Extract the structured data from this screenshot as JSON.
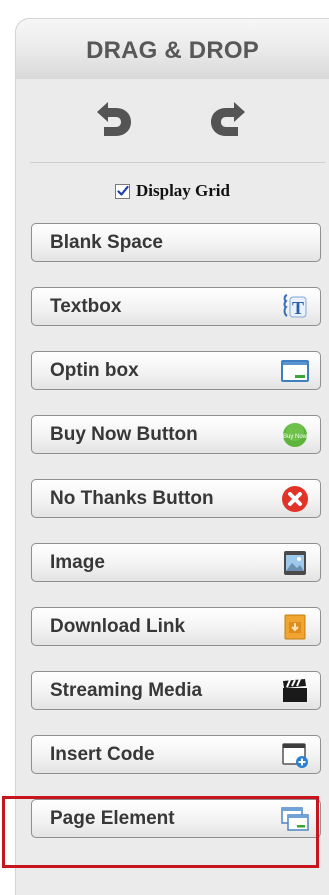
{
  "panel": {
    "title": "DRAG & DROP",
    "toolbar": {
      "undo_icon": "undo-icon",
      "redo_icon": "redo-icon"
    },
    "display_grid": {
      "label": "Display Grid",
      "checked": true
    }
  },
  "elements": [
    {
      "label": "Blank Space",
      "icon": ""
    },
    {
      "label": "Textbox",
      "icon": "textbox-icon"
    },
    {
      "label": "Optin box",
      "icon": "optin-box-icon"
    },
    {
      "label": "Buy Now Button",
      "icon": "buy-now-icon",
      "icon_text": "Buy Now"
    },
    {
      "label": "No Thanks Button",
      "icon": "no-thanks-icon"
    },
    {
      "label": "Image",
      "icon": "image-icon"
    },
    {
      "label": "Download Link",
      "icon": "download-icon"
    },
    {
      "label": "Streaming Media",
      "icon": "streaming-media-icon"
    },
    {
      "label": "Insert Code",
      "icon": "insert-code-icon"
    },
    {
      "label": "Page Element",
      "icon": "page-element-icon",
      "highlighted": true
    }
  ],
  "colors": {
    "highlight": "#c8141c",
    "buy_now": "#5cb53a",
    "no_thanks": "#e23328"
  }
}
